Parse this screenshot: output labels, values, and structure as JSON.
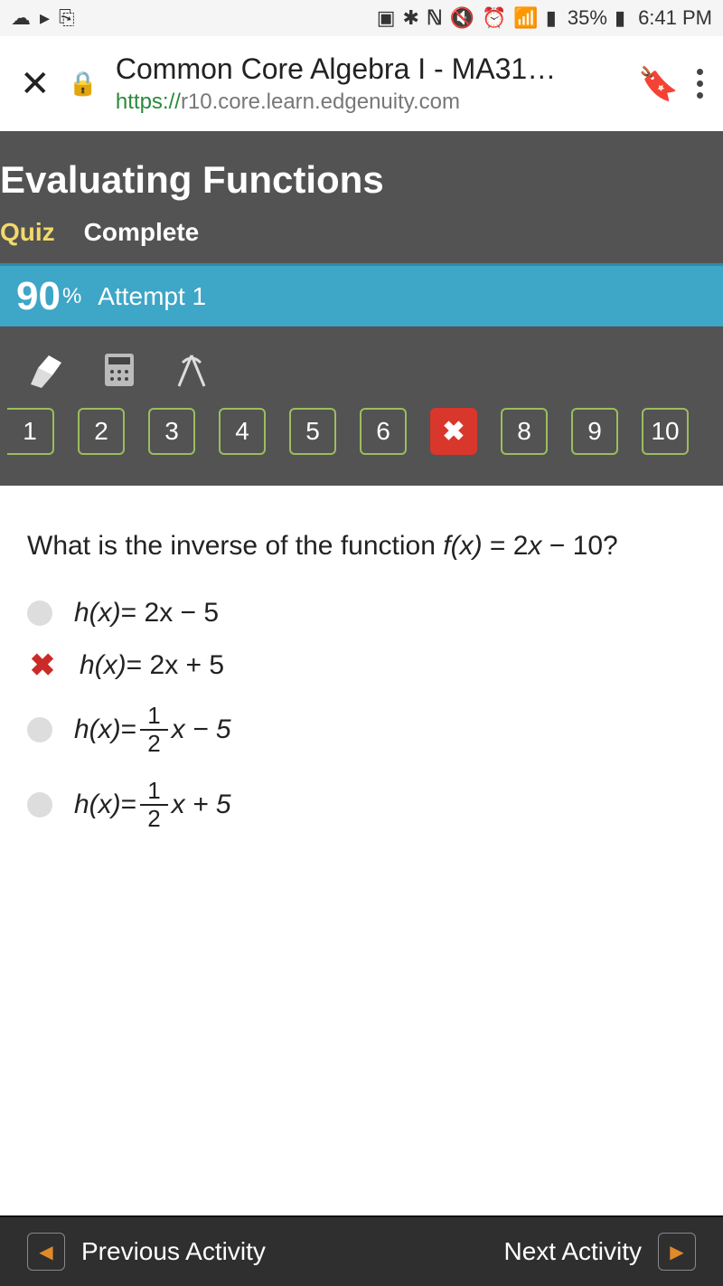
{
  "status": {
    "battery": "35%",
    "time": "6:41 PM"
  },
  "browser": {
    "title": "Common Core Algebra I - MA31…",
    "url_scheme": "https://",
    "url_rest": "r10.core.learn.edgenuity.com"
  },
  "lesson": {
    "title": "Evaluating Functions",
    "quiz_label": "Quiz",
    "complete_label": "Complete"
  },
  "score": {
    "value": "90",
    "pct": "%",
    "attempt": "Attempt 1"
  },
  "questions": {
    "items": [
      "1",
      "2",
      "3",
      "4",
      "5",
      "6",
      "✖",
      "8",
      "9",
      "10"
    ],
    "wrong_index": 6
  },
  "question": {
    "prompt_pre": "What is the inverse of the function ",
    "prompt_fx": "f(x)",
    "prompt_eq": " = 2",
    "prompt_x": "x",
    "prompt_post": " − 10?"
  },
  "answers": {
    "a1_pre": "h(x)",
    "a1_rest": " = 2x − 5",
    "a2_pre": "h(x)",
    "a2_rest": " = 2x + 5",
    "a3_pre": "h(x)",
    "a3_eq": " = ",
    "a3_num": "1",
    "a3_den": "2",
    "a3_post": "x − 5",
    "a4_pre": "h(x)",
    "a4_eq": " = ",
    "a4_num": "1",
    "a4_den": "2",
    "a4_post": "x + 5"
  },
  "nav": {
    "prev": "Previous Activity",
    "next": "Next Activity"
  }
}
